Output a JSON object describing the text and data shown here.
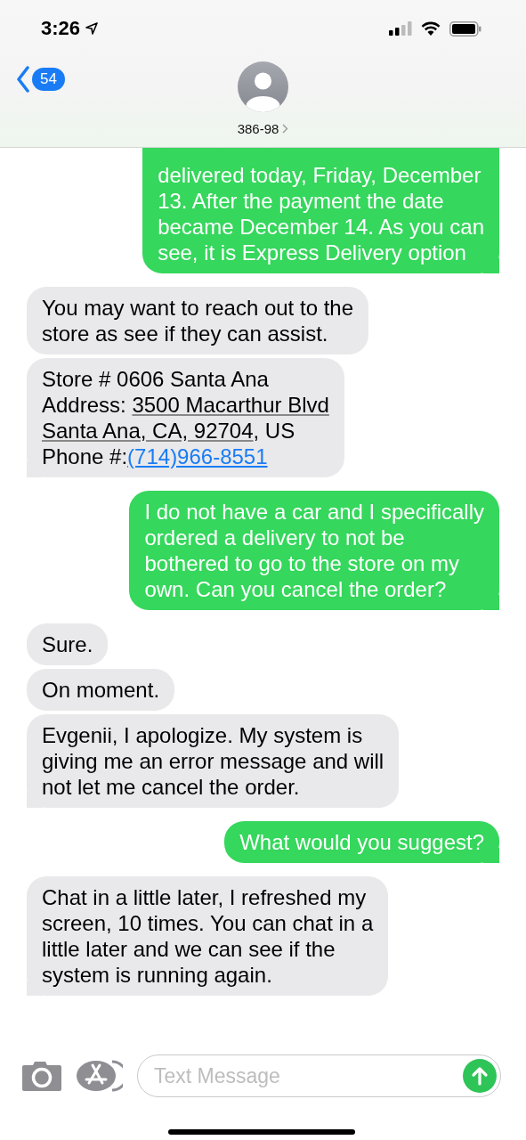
{
  "status_bar": {
    "time": "3:26"
  },
  "nav": {
    "back_badge": "54",
    "contact": "386-98"
  },
  "messages": [
    {
      "kind": "sent",
      "lines": [
        "delivered today, Friday, December",
        "13. After the payment the date",
        "became December 14. As you can",
        "see, it is Express Delivery option"
      ]
    },
    {
      "kind": "received",
      "lines": [
        "You may want to reach out to the",
        "store as see if they can assist."
      ]
    },
    {
      "kind": "received",
      "lines": [
        [
          {
            "kind": "text",
            "text": "Store # 0606 Santa Ana"
          }
        ],
        [
          {
            "kind": "text",
            "text": "Address: "
          },
          {
            "kind": "address",
            "text": "3500 Macarthur Blvd"
          }
        ],
        [
          {
            "kind": "address",
            "text": "Santa Ana, CA, 92704"
          },
          {
            "kind": "text",
            "text": ", US"
          }
        ],
        [
          {
            "kind": "text",
            "text": "Phone #:"
          },
          {
            "kind": "phone",
            "text": "(714)966-8551"
          }
        ]
      ]
    },
    {
      "kind": "sent",
      "lines": [
        "I do not have a car and I specifically",
        "ordered a delivery to not be",
        "bothered to go to the store on my",
        "own. Can you cancel the order?"
      ]
    },
    {
      "kind": "received",
      "lines": [
        "Sure."
      ]
    },
    {
      "kind": "received",
      "lines": [
        "On moment."
      ]
    },
    {
      "kind": "received",
      "lines": [
        "Evgenii, I apologize. My system is",
        "giving me an error message and will",
        "not let me cancel the order."
      ]
    },
    {
      "kind": "sent",
      "lines": [
        "What would you suggest?"
      ]
    },
    {
      "kind": "received",
      "lines": [
        "Chat in a little later, I refreshed my",
        "screen, 10 times. You can chat in a",
        "little later and we can see if the",
        "system is running again."
      ]
    }
  ],
  "composer": {
    "placeholder": "Text Message"
  }
}
